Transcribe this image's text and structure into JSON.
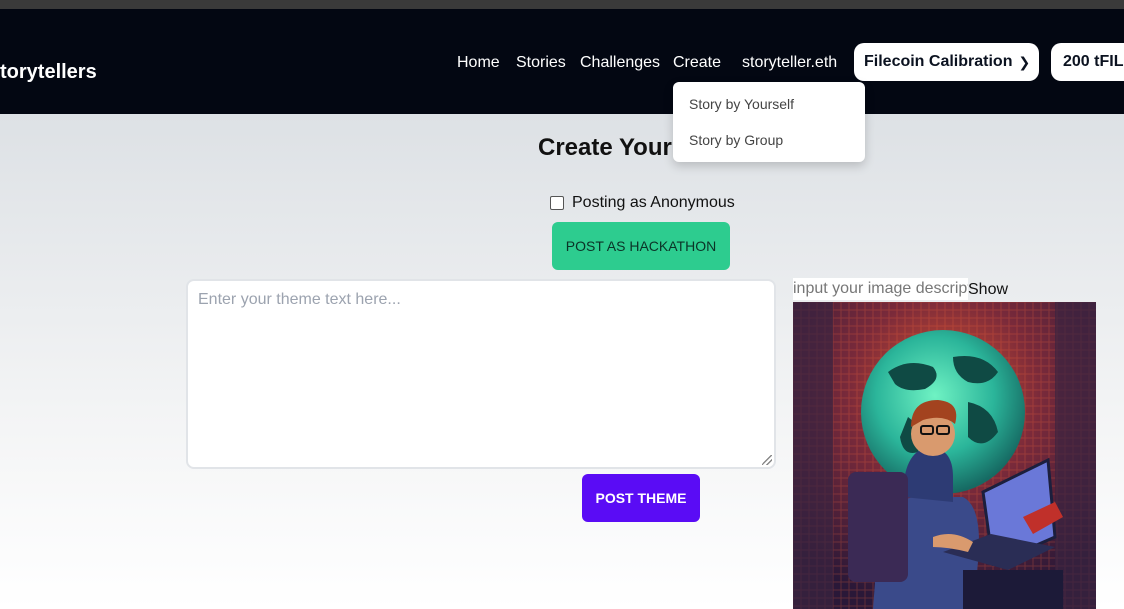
{
  "navbar": {
    "brand": "torytellers",
    "links": [
      "Home",
      "Stories",
      "Challenges",
      "Create"
    ],
    "ens_name": "storyteller.eth",
    "network": "Filecoin Calibration",
    "balance": "200 tFIL"
  },
  "create_menu": {
    "items": [
      "Story by Yourself",
      "Story by Group"
    ]
  },
  "main": {
    "heading": "Create Your T",
    "anonymous_label": "Posting as Anonymous",
    "anonymous_checked": false,
    "hackathon_button": "POST AS HACKATHON",
    "theme_placeholder": "Enter your theme text here...",
    "post_theme_button": "POST THEME",
    "image_input_placeholder": "input your image description",
    "show_button": "Show",
    "image_subject": "hacker at laptop with glowing globe"
  },
  "colors": {
    "navbar_bg": "#030712",
    "hackathon_button": "#2dcc8f",
    "post_theme_button": "#5a0cf5"
  },
  "icons": [
    "chevron-down-icon"
  ]
}
